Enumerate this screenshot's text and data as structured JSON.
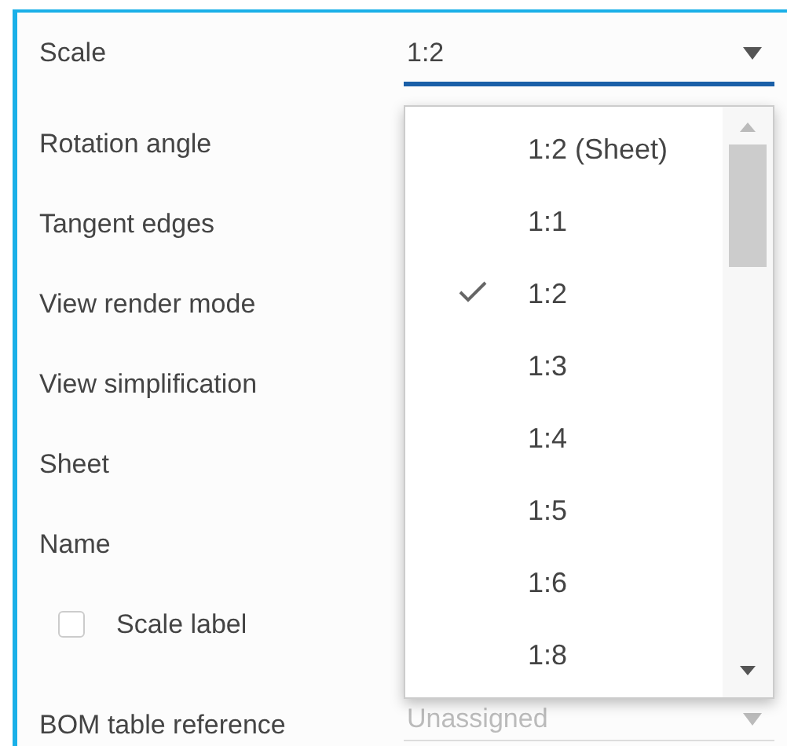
{
  "fields": [
    {
      "kind": "dropdown",
      "label": "Scale",
      "value": "1:2",
      "expanded": true
    },
    {
      "kind": "label",
      "label": "Rotation angle"
    },
    {
      "kind": "label",
      "label": "Tangent edges"
    },
    {
      "kind": "label",
      "label": "View render mode"
    },
    {
      "kind": "label",
      "label": "View simplification"
    },
    {
      "kind": "label",
      "label": "Sheet"
    },
    {
      "kind": "label",
      "label": "Name"
    },
    {
      "kind": "checkbox",
      "label": "Scale label",
      "checked": false
    },
    {
      "kind": "dropdown",
      "label": "BOM table reference",
      "value": "Unassigned",
      "expanded": false
    }
  ],
  "scale_options": [
    {
      "label": "1:2 (Sheet)",
      "selected": false
    },
    {
      "label": "1:1",
      "selected": false
    },
    {
      "label": "1:2",
      "selected": true
    },
    {
      "label": "1:3",
      "selected": false
    },
    {
      "label": "1:4",
      "selected": false
    },
    {
      "label": "1:5",
      "selected": false
    },
    {
      "label": "1:6",
      "selected": false
    },
    {
      "label": "1:8",
      "selected": false
    }
  ]
}
